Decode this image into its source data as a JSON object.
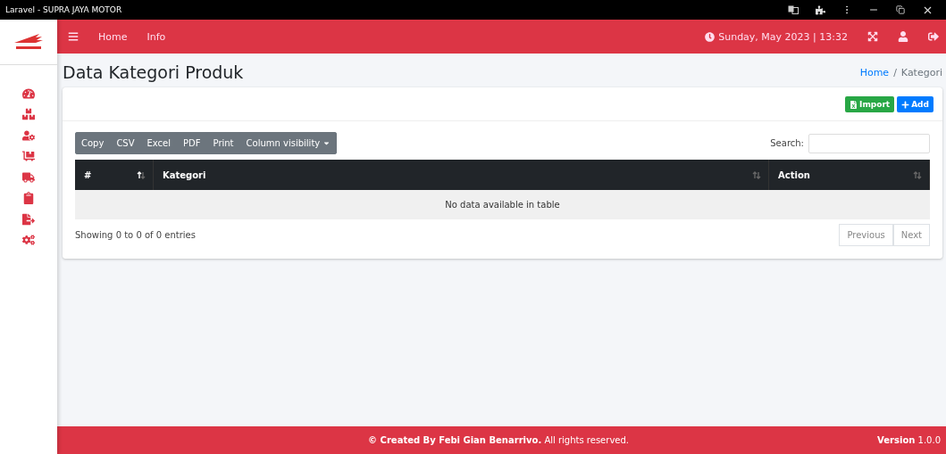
{
  "browser": {
    "title": "Laravel - SUPRA JAYA MOTOR"
  },
  "sidebar": {
    "items": [
      {
        "selected": false
      },
      {
        "selected": false
      },
      {
        "selected": false
      },
      {
        "selected": false
      },
      {
        "selected": false
      },
      {
        "selected": false
      },
      {
        "selected": false
      },
      {
        "selected": false
      }
    ]
  },
  "navbar": {
    "links": [
      "Home",
      "Info"
    ],
    "datetime": "Sunday, May 2023 | 13:32"
  },
  "page": {
    "title": "Data Kategori Produk",
    "breadcrumb": [
      {
        "label": "Home",
        "link": true
      },
      {
        "label": "Kategori",
        "link": false
      }
    ],
    "breadcrumb_separator": "/"
  },
  "actions": [
    {
      "label": "Import",
      "kind": "import"
    },
    {
      "label": "Add",
      "kind": "add"
    }
  ],
  "export_buttons": [
    "Copy",
    "CSV",
    "Excel",
    "PDF",
    "Print",
    "Column visibility"
  ],
  "search": {
    "label": "Search:"
  },
  "table": {
    "columns": [
      {
        "label": "#",
        "sorted": true
      },
      {
        "label": "Kategori",
        "sorted": false
      },
      {
        "label": "Action",
        "sorted": false
      }
    ],
    "empty": "No data available in table"
  },
  "info": "Showing 0 to 0 of 0 entries",
  "pagination": [
    {
      "label": "Previous",
      "disabled": true
    },
    {
      "label": "Next",
      "disabled": true
    }
  ],
  "footer": {
    "credit": "**© Created By Febi Gian Benarrivo.** All rights reserved.",
    "version": "**Version** 1.0.0"
  }
}
